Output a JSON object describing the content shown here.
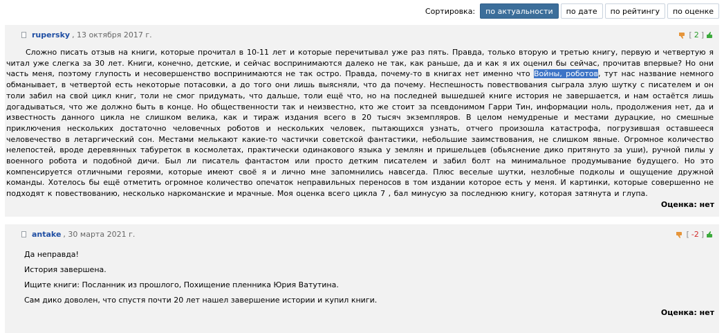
{
  "sort": {
    "label": "Сортировка:",
    "options": [
      "по актуальности",
      "по дате",
      "по рейтингу",
      "по оценке"
    ],
    "active": "по актуальности"
  },
  "reviews": [
    {
      "author": "rupersky",
      "date": ", 13 октября 2017 г.",
      "score": "2",
      "text_before": "Сложно писать отзыв на книги, которые прочитал в 10-11 лет и которые перечитывал уже раз пять. Правда, только вторую и третью книгу, первую и четвертую я читал уже слегка за 30 лет. Книги, конечно, детские, и сейчас воспринимаются далеко не так, как раньше, да и как я их оценил бы сейчас, прочитав впервые? Но они часть меня, поэтому глупость и несовершенство воспринимаются не так остро. Правда, почему-то в книгах нет именно что ",
      "highlight": "Войны, роботов",
      "text_after": ", тут нас название немного обманывает, в четвертой есть некоторые потасовки, а до того они лишь выясняли, что да почему. Неспешность повествования сыграла злую шутку с писателем и он толи забил на свой цикл книг, толи не смог придумать, что дальше, толи ещё что, но на последней вышедшей книге история не завершается, и нам остаётся лишь догадываться, что же должно быть в конце. Но общественности так и неизвестно, кто же стоит за псевдонимом Гарри Тин, информации ноль, продолжения нет, да и известность данного цикла не слишком велика, как и тираж издания всего в 20 тысяч экземпляров. В целом немудреные и местами дурацкие, но смешные приключения нескольких достаточно человечных роботов и нескольких человек, пытающихся узнать, отчего произошла катастрофа, погрузившая оставшееся человечество в летаргический сон. Местами мелькают какие-то частички советской фантастики, небольшие заимствования, не слишком явные. Огромное количество нелепостей, вроде деревянных табуреток в космолетах, практически одинакового языка у землян и пришельцев (обьяснение дико притянуто за уши), ручной пилы у военного робота и подобной дичи. Был ли писатель фантастом или просто детким писателем и забил болт на минимальное продумывание будущего. Но это компенсируется отличными героями, которые имеют своё я и лично мне запомнились навсегда. Плюс веселые шутки, незлобные подколы и ощущение дружной команды. Хотелось бы ещё отметить огромное количество опечаток неправильных переносов в том издании которое есть у меня. И картинки, которые совершенно не подходят к повествованию, несколько наркоманские и мрачные. Моя оценка всего цикла 7 , бал минусую за последнюю книгу, которая затянута и глупа.",
      "rating": "Оценка: нет"
    },
    {
      "author": "antake",
      "date": ", 30 марта 2021 г.",
      "score": "-2",
      "lines": [
        "Да неправда!",
        "История завершена.",
        "Ищите книги: Посланник из прошлого, Похищение пленника Юрия Ватутина.",
        "Сам дико доволен, что спустя почти 20 лет нашел завершение истории и купил книги."
      ],
      "rating": "Оценка: нет"
    }
  ],
  "colors": {
    "active_sort_bg": "#3c6e9a",
    "author_link": "#1f4ea3",
    "score_positive": "#2a9d2a",
    "score_negative": "#d12a2a",
    "review_bg": "#f2f2f2",
    "highlight_bg": "#3d74c6"
  },
  "icons": [
    "document-icon",
    "thumb-down-icon",
    "thumb-up-icon"
  ]
}
